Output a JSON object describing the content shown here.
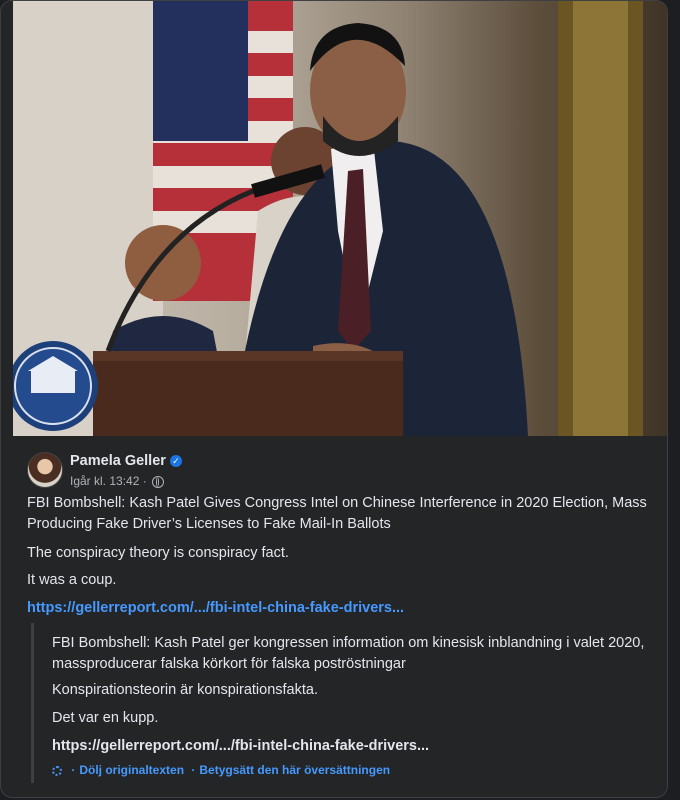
{
  "post": {
    "author": "Pamela Geller",
    "time": "Igår kl. 13:42",
    "text": [
      "FBI Bombshell: Kash Patel Gives Congress Intel on Chinese Interference in 2020 Election, Mass Producing Fake Driver’s Licenses to Fake Mail-In Ballots",
      "The conspiracy theory is conspiracy fact.",
      "It was a coup."
    ],
    "link": "https://gellerreport.com/.../fbi-intel-china-fake-drivers...",
    "translation": {
      "lines": [
        "FBI Bombshell: Kash Patel ger kongressen information om kinesisk inblandning i valet 2020, massproducerar falska körkort för falska poströstningar",
        "Konspirationsteorin är konspirationsfakta.",
        "Det var en kupp."
      ],
      "link": "https://gellerreport.com/.../fbi-intel-china-fake-drivers...",
      "hide_label": "Dölj originaltexten",
      "rate_label": "Betygsätt den här översättningen"
    },
    "icons": {
      "verified": "verified-badge-icon",
      "audience": "globe-icon",
      "translate": "gear-icon"
    }
  },
  "colors": {
    "accent": "#4599ff",
    "background": "#242526"
  }
}
